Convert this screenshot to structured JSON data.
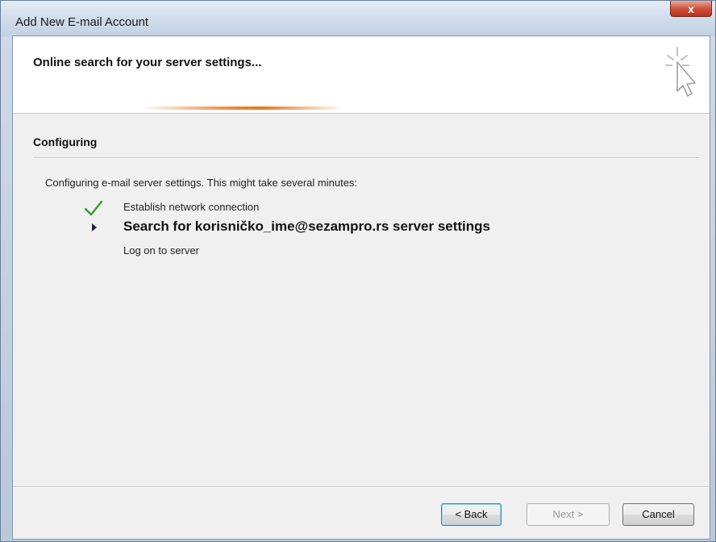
{
  "window": {
    "title": "Add New E-mail Account",
    "close_glyph": "x"
  },
  "header": {
    "title": "Online search for your server settings...",
    "icon": "wizard-cursor-icon",
    "progress_accent": "#e8873a"
  },
  "section": {
    "title": "Configuring"
  },
  "description": "Configuring e-mail server settings. This might take several minutes:",
  "steps": [
    {
      "label": "Establish network connection",
      "status": "done",
      "icon": "checkmark-icon"
    },
    {
      "label": "Search for korisničko_ime@sezampro.rs server settings",
      "status": "in-progress",
      "icon": "arrow-right-icon"
    },
    {
      "label": "Log on to server",
      "status": "pending",
      "icon": ""
    }
  ],
  "buttons": {
    "back": "< Back",
    "next": "Next >",
    "cancel": "Cancel"
  }
}
